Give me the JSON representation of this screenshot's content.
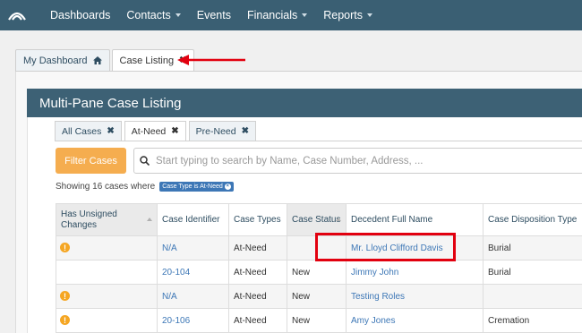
{
  "navbar": {
    "logo_icon": "arc-logo-icon",
    "items": [
      {
        "label": "Dashboards",
        "dropdown": false
      },
      {
        "label": "Contacts",
        "dropdown": true
      },
      {
        "label": "Events",
        "dropdown": false
      },
      {
        "label": "Financials",
        "dropdown": true
      },
      {
        "label": "Reports",
        "dropdown": true
      }
    ],
    "background": "#3a5f73"
  },
  "page_tabs": [
    {
      "label": "My Dashboard",
      "icon": "home-icon"
    },
    {
      "label": "Case Listing",
      "icon": "close-icon",
      "active": true
    }
  ],
  "panel": {
    "title": "Multi-Pane Case Listing",
    "sub_tabs": [
      {
        "label": "All Cases"
      },
      {
        "label": "At-Need",
        "active": true
      },
      {
        "label": "Pre-Need"
      }
    ],
    "filter_button": "Filter Cases",
    "search_placeholder": "Start typing to search by Name, Case Number, Address, ...",
    "showing_text": "Showing 16 cases where",
    "filter_badge": "Case Type is At-Need",
    "columns": [
      "Has Unsigned Changes",
      "Case Identifier",
      "Case Types",
      "Case Status",
      "Decedent Full Name",
      "Case Disposition Type"
    ],
    "rows": [
      {
        "warning": true,
        "case_id": "N/A",
        "case_type": "At-Need",
        "status": "",
        "name": "Mr. Lloyd Clifford Davis",
        "disposition": "Burial"
      },
      {
        "warning": false,
        "case_id": "20-104",
        "case_type": "At-Need",
        "status": "New",
        "name": "Jimmy John",
        "disposition": "Burial"
      },
      {
        "warning": true,
        "case_id": "N/A",
        "case_type": "At-Need",
        "status": "New",
        "name": "Testing Roles",
        "disposition": ""
      },
      {
        "warning": true,
        "case_id": "20-106",
        "case_type": "At-Need",
        "status": "New",
        "name": "Amy Jones",
        "disposition": "Cremation"
      }
    ]
  },
  "colors": {
    "header": "#3d6175",
    "filter_button": "#f5ad4f",
    "link": "#3d77b6",
    "warning": "#f5a623",
    "annotation": "#e2000f"
  }
}
